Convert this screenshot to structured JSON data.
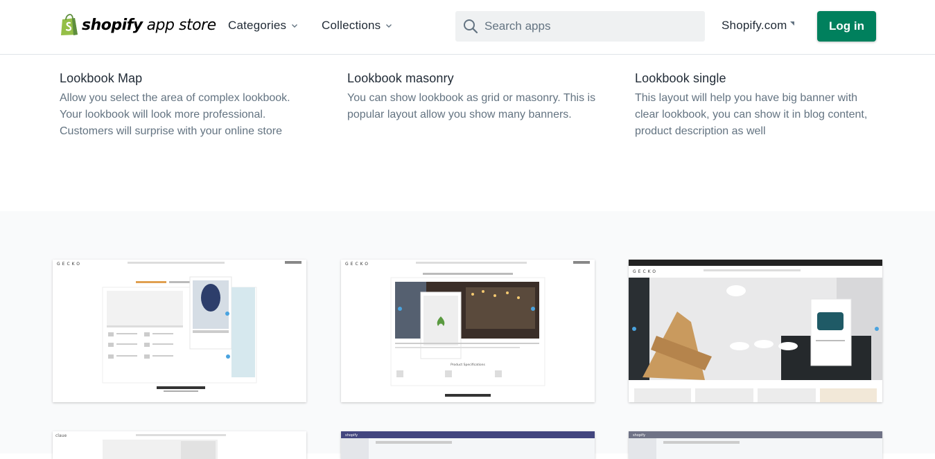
{
  "header": {
    "logo_bold": "shopify",
    "logo_light": "app store",
    "nav": [
      {
        "label": "Categories"
      },
      {
        "label": "Collections"
      }
    ],
    "search_placeholder": "Search apps",
    "shopify_link": "Shopify.com",
    "login_label": "Log in"
  },
  "features": [
    {
      "title": "Lookbook Map",
      "desc": "Allow you select the area of complex lookbook. Your lookbook will look more professional. Customers will surprise with your online store"
    },
    {
      "title": "Lookbook masonry",
      "desc": "You can show lookbook as grid or masonry. This is popular layout allow you show many banners."
    },
    {
      "title": "Lookbook single",
      "desc": "This layout will help you have big banner with clear lookbook, you can show it in blog content, product description as well"
    }
  ],
  "screenshots": {
    "brand": "GECKO",
    "shot1_tabs": [
      "DESCRIPTION",
      "ADDITIONAL INFORMATION"
    ],
    "shot1_footer": "Related product",
    "shot2_footer": "Related product",
    "shot2_specs": "Product Specifications",
    "bottom_brand": "claue",
    "bottom_brand_2": "shopify"
  },
  "colors": {
    "accent": "#00805d",
    "logo_green": "#95bf47",
    "logo_green_dark": "#5e8e3e",
    "gallery_bg": "#f9fafb"
  }
}
